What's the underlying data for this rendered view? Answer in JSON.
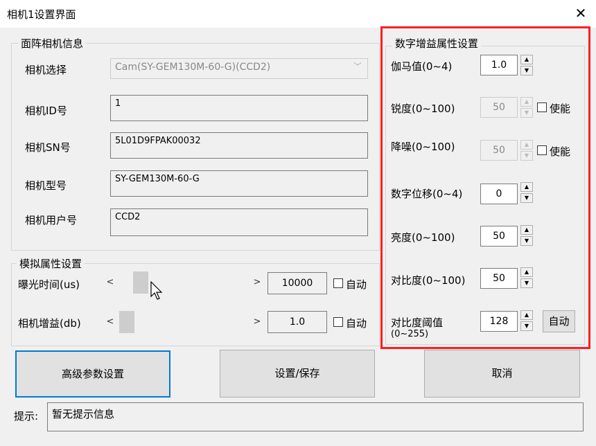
{
  "window": {
    "title": "相机1设置界面",
    "close_glyph": "✕"
  },
  "camera_info": {
    "legend": "面阵相机信息",
    "select_label": "相机选择",
    "select_value": "Cam(SY-GEM130M-60-G)(CCD2)",
    "id_label": "相机ID号",
    "id_value": "1",
    "sn_label": "相机SN号",
    "sn_value": "5L01D9FPAK00032",
    "model_label": "相机型号",
    "model_value": "SY-GEM130M-60-G",
    "user_label": "相机用户号",
    "user_value": "CCD2"
  },
  "analog": {
    "legend": "模拟属性设置",
    "exposure_label": "曝光时间(us)",
    "exposure_value": "10000",
    "exposure_auto": "自动",
    "exposure_level": 0.12,
    "gain_label": "相机增益(db)",
    "gain_value": "1.0",
    "gain_auto": "自动",
    "gain_level": 0.0,
    "left_arrow": "<",
    "right_arrow": ">"
  },
  "digital": {
    "legend": "数字增益属性设置",
    "gamma_label": "伽马值(0~4)",
    "gamma_value": "1.0",
    "sharp_label": "锐度(0~100)",
    "sharp_value": "50",
    "sharp_enable": "使能",
    "denoise_label": "降噪(0~100)",
    "denoise_value": "50",
    "denoise_enable": "使能",
    "shift_label": "数字位移(0~4)",
    "shift_value": "0",
    "bright_label": "亮度(0~100)",
    "bright_value": "50",
    "contrast_label": "对比度(0~100)",
    "contrast_value": "50",
    "thresh_label": "对比度阈值",
    "thresh_range": "(0~255)",
    "thresh_value": "128",
    "thresh_auto": "自动"
  },
  "buttons": {
    "advanced": "高级参数设置",
    "save": "设置/保存",
    "cancel": "取消"
  },
  "hint": {
    "label": "提示:",
    "value": "暂无提示信息"
  },
  "colors": {
    "highlight": "#ff1e1e",
    "focus": "#0078d7"
  }
}
